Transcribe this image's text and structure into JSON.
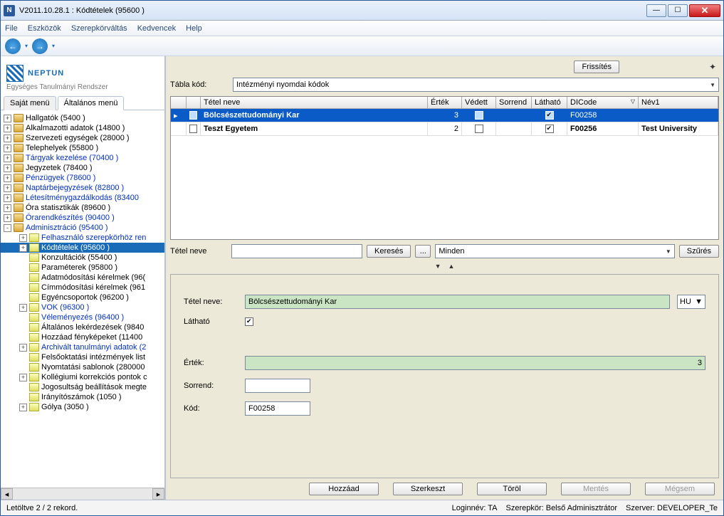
{
  "window": {
    "title": "V2011.10.28.1 : Kódtételek (95600  )"
  },
  "menu": {
    "file": "File",
    "tools": "Eszközök",
    "roleswitch": "Szerepkörváltás",
    "favs": "Kedvencek",
    "help": "Help"
  },
  "logo": {
    "name": "NEPTUN",
    "sub": "Egységes Tanulmányi Rendszer"
  },
  "tabs": {
    "own": "Saját menü",
    "general": "Általános menü"
  },
  "tree": [
    {
      "d": 0,
      "exp": "+",
      "ico": "book",
      "link": false,
      "sel": false,
      "txt": "Hallgatók (5400  )"
    },
    {
      "d": 0,
      "exp": "+",
      "ico": "book",
      "link": false,
      "sel": false,
      "txt": "Alkalmazotti adatok (14800  )"
    },
    {
      "d": 0,
      "exp": "+",
      "ico": "book",
      "link": false,
      "sel": false,
      "txt": "Szervezeti egységek (28000  )"
    },
    {
      "d": 0,
      "exp": "+",
      "ico": "book",
      "link": false,
      "sel": false,
      "txt": "Telephelyek (55800  )"
    },
    {
      "d": 0,
      "exp": "+",
      "ico": "book",
      "link": true,
      "sel": false,
      "txt": "Tárgyak kezelése (70400  )"
    },
    {
      "d": 0,
      "exp": "+",
      "ico": "book",
      "link": false,
      "sel": false,
      "txt": "Jegyzetek (78400  )"
    },
    {
      "d": 0,
      "exp": "+",
      "ico": "book",
      "link": true,
      "sel": false,
      "txt": "Pénzügyek (78600  )"
    },
    {
      "d": 0,
      "exp": "+",
      "ico": "book",
      "link": true,
      "sel": false,
      "txt": "Naptárbejegyzések (82800  )"
    },
    {
      "d": 0,
      "exp": "+",
      "ico": "book",
      "link": true,
      "sel": false,
      "txt": "Létesítménygazdálkodás (83400 "
    },
    {
      "d": 0,
      "exp": "+",
      "ico": "book",
      "link": false,
      "sel": false,
      "txt": "Óra statisztikák (89600  )"
    },
    {
      "d": 0,
      "exp": "+",
      "ico": "book",
      "link": true,
      "sel": false,
      "txt": "Órarendkészítés (90400  )"
    },
    {
      "d": 0,
      "exp": "-",
      "ico": "book",
      "link": true,
      "sel": false,
      "txt": "Adminisztráció (95400  )"
    },
    {
      "d": 1,
      "exp": "+",
      "ico": "doc",
      "link": true,
      "sel": false,
      "txt": "Felhasználó szerepkörhöz ren"
    },
    {
      "d": 1,
      "exp": "+",
      "ico": "doc",
      "link": true,
      "sel": true,
      "txt": "Kódtételek (95600  )"
    },
    {
      "d": 1,
      "exp": "",
      "ico": "doc",
      "link": false,
      "sel": false,
      "txt": "Konzultációk (55400  )"
    },
    {
      "d": 1,
      "exp": "",
      "ico": "doc",
      "link": false,
      "sel": false,
      "txt": "Paraméterek (95800  )"
    },
    {
      "d": 1,
      "exp": "",
      "ico": "doc",
      "link": false,
      "sel": false,
      "txt": "Adatmódosítási kérelmek (96("
    },
    {
      "d": 1,
      "exp": "",
      "ico": "doc",
      "link": false,
      "sel": false,
      "txt": "Címmódosítási kérelmek (961"
    },
    {
      "d": 1,
      "exp": "",
      "ico": "doc",
      "link": false,
      "sel": false,
      "txt": "Egyéncsoportok (96200  )"
    },
    {
      "d": 1,
      "exp": "+",
      "ico": "doc",
      "link": true,
      "sel": false,
      "txt": "VOK (96300  )"
    },
    {
      "d": 1,
      "exp": "",
      "ico": "doc",
      "link": true,
      "sel": false,
      "txt": "Véleményezés (96400  )"
    },
    {
      "d": 1,
      "exp": "",
      "ico": "doc",
      "link": false,
      "sel": false,
      "txt": "Általános lekérdezések (9840"
    },
    {
      "d": 1,
      "exp": "",
      "ico": "doc",
      "link": false,
      "sel": false,
      "txt": "Hozzáad fényképeket (11400"
    },
    {
      "d": 1,
      "exp": "+",
      "ico": "doc",
      "link": true,
      "sel": false,
      "txt": "Archivált tanulmányi adatok (2"
    },
    {
      "d": 1,
      "exp": "",
      "ico": "doc",
      "link": false,
      "sel": false,
      "txt": "Felsőoktatási intézmények list"
    },
    {
      "d": 1,
      "exp": "",
      "ico": "doc",
      "link": false,
      "sel": false,
      "txt": "Nyomtatási sablonok (280000"
    },
    {
      "d": 1,
      "exp": "+",
      "ico": "doc",
      "link": false,
      "sel": false,
      "txt": "Kollégiumi korrekciós pontok c"
    },
    {
      "d": 1,
      "exp": "",
      "ico": "doc",
      "link": false,
      "sel": false,
      "txt": "Jogosultság beállítások megte"
    },
    {
      "d": 1,
      "exp": "",
      "ico": "doc",
      "link": false,
      "sel": false,
      "txt": "Irányítószámok (1050  )"
    },
    {
      "d": 1,
      "exp": "+",
      "ico": "doc",
      "link": false,
      "sel": false,
      "txt": "Gólya (3050  )"
    }
  ],
  "top": {
    "refresh": "Frissítés",
    "tablacode_lbl": "Tábla kód:",
    "tablacode_val": "Intézményi nyomdai kódok"
  },
  "grid": {
    "cols": {
      "name": "Tétel neve",
      "val": "Érték",
      "prot": "Védett",
      "ord": "Sorrend",
      "vis": "Látható",
      "dicode": "DICode",
      "sort": "▽",
      "name1": "Név1"
    },
    "rows": [
      {
        "sel": true,
        "chk": false,
        "name": "Bölcsészettudományi Kar",
        "val": "3",
        "prot": false,
        "ord": "",
        "vis": true,
        "dicode": "F00258",
        "name1": ""
      },
      {
        "sel": false,
        "chk": false,
        "name": "Teszt Egyetem",
        "val": "2",
        "prot": false,
        "ord": "",
        "vis": true,
        "dicode": "F00256",
        "name1": "Test University"
      }
    ]
  },
  "search": {
    "lbl": "Tétel neve",
    "btn": "Keresés",
    "more": "...",
    "filterdd": "Minden",
    "filter_btn": "Szűrés"
  },
  "detail": {
    "name_lbl": "Tétel neve:",
    "name_val": "Bölcsészettudományi Kar",
    "lang": "HU",
    "vis_lbl": "Látható",
    "vis_val": true,
    "val_lbl": "Érték:",
    "val_val": "3",
    "ord_lbl": "Sorrend:",
    "ord_val": "",
    "code_lbl": "Kód:",
    "code_val": "F00258"
  },
  "actions": {
    "add": "Hozzáad",
    "edit": "Szerkeszt",
    "del": "Töröl",
    "save": "Mentés",
    "cancel": "Mégsem"
  },
  "status": {
    "records": "Letöltve 2 / 2 rekord.",
    "login": "Loginnév: TA",
    "role": "Szerepkör: Belső Adminisztrátor",
    "server": "Szerver: DEVELOPER_Te"
  }
}
